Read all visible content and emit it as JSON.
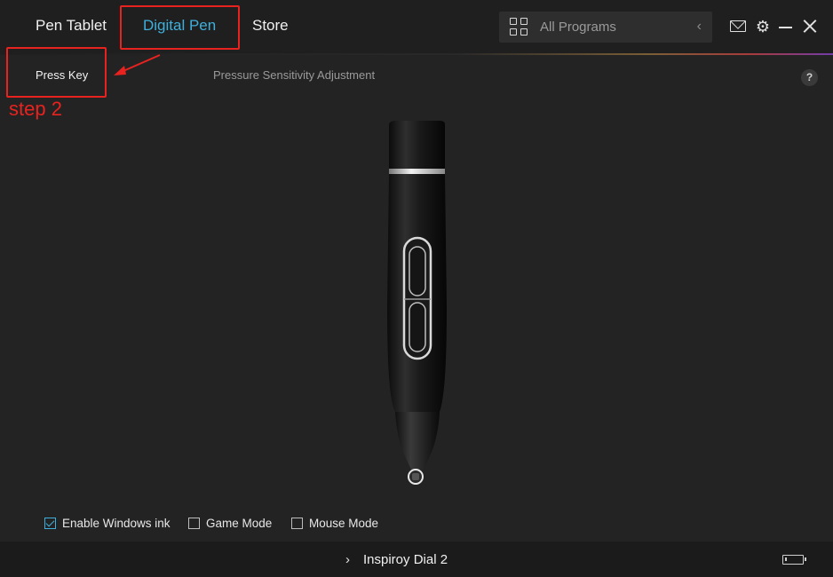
{
  "header": {
    "tabs": [
      {
        "label": "Pen Tablet",
        "active": false
      },
      {
        "label": "Digital Pen",
        "active": true
      },
      {
        "label": "Store",
        "active": false
      }
    ],
    "program_select": {
      "label": "All Programs",
      "icon": "grid-icon"
    },
    "icons": [
      "mail-icon",
      "gear-icon",
      "minimize-icon",
      "close-icon"
    ]
  },
  "subnav": {
    "items": [
      {
        "label": "Press Key",
        "active": true
      },
      {
        "label": "Pressure Sensitivity Adjustment",
        "active": false
      }
    ],
    "help_label": "?"
  },
  "annotation": {
    "step_label": "step 2",
    "color": "#e8231f"
  },
  "options": [
    {
      "label": "Enable Windows ink",
      "checked": true
    },
    {
      "label": "Game Mode",
      "checked": false
    },
    {
      "label": "Mouse Mode",
      "checked": false
    }
  ],
  "footer": {
    "device_name": "Inspiroy Dial 2",
    "battery_level": 0.1
  },
  "colors": {
    "accent": "#3fb0dc",
    "background": "#232323",
    "annotation": "#e8231f"
  }
}
